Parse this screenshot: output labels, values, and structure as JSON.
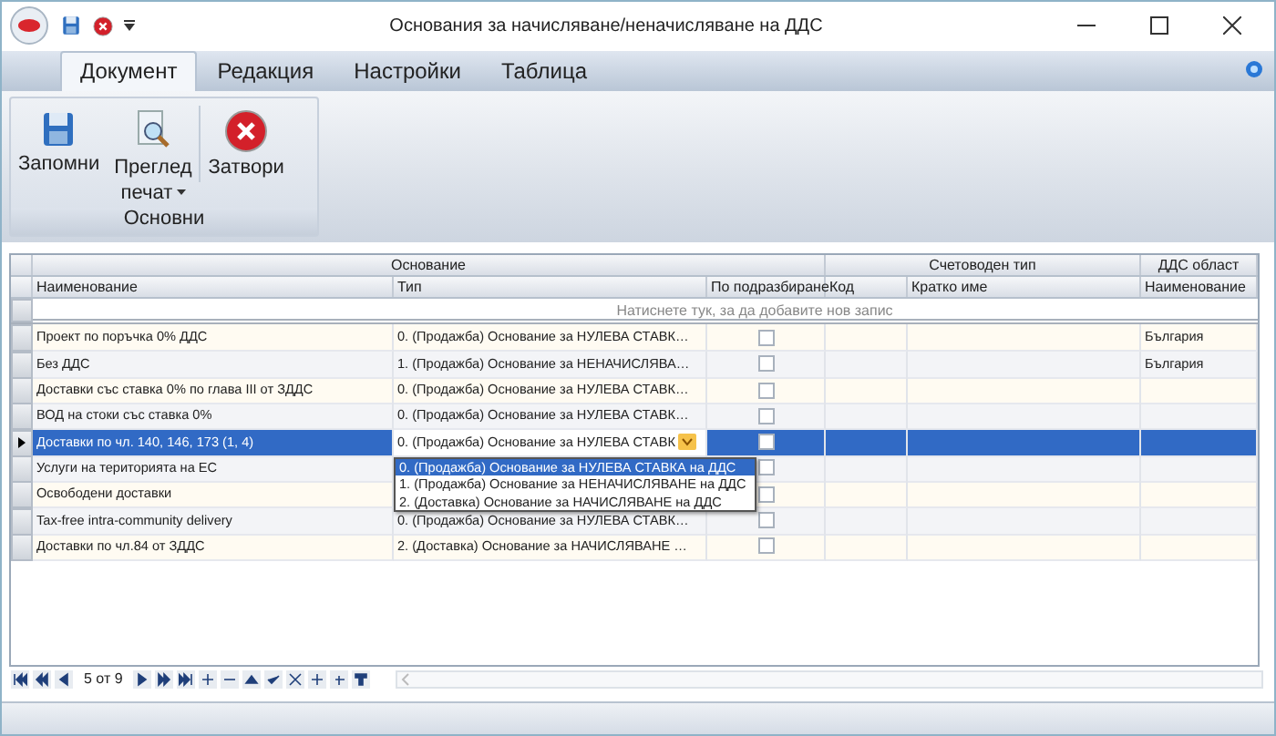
{
  "window": {
    "title": "Основания за начисляване/неначисляване на ДДС"
  },
  "tabs": [
    {
      "label": "Документ",
      "selected": true
    },
    {
      "label": "Редакция",
      "selected": false
    },
    {
      "label": "Настройки",
      "selected": false
    },
    {
      "label": "Таблица",
      "selected": false
    }
  ],
  "ribbon": {
    "group": "Основни",
    "buttons": [
      {
        "kind": "save",
        "lines": [
          "Запомни"
        ],
        "has_menu": false
      },
      {
        "kind": "preview",
        "lines": [
          "Преглед",
          "печат"
        ],
        "has_menu": true
      },
      {
        "kind": "close",
        "lines": [
          "Затвори"
        ],
        "has_menu": false
      }
    ]
  },
  "grid": {
    "bands": [
      {
        "label": "Основание",
        "columns": [
          "Наименование",
          "Тип",
          "По подразбиране"
        ]
      },
      {
        "label": "Счетоводен тип",
        "columns": [
          "Код",
          "Кратко име"
        ]
      },
      {
        "label": "ДДС област",
        "columns": [
          "Наименование"
        ]
      }
    ],
    "new_row_hint": "Натиснете тук, за да добавите нов запис",
    "rows": [
      {
        "name": "Проект по поръчка 0% ДДС",
        "type": "0. (Продажба) Основание за НУЛЕВА СТАВК…",
        "default": false,
        "vat_area": "България",
        "selected": false
      },
      {
        "name": "Без ДДС",
        "type": "1. (Продажба) Основание за НЕНАЧИСЛЯВА…",
        "default": false,
        "vat_area": "България",
        "selected": false
      },
      {
        "name": "Доставки със ставка 0% по глава III от ЗДДС",
        "type": "0. (Продажба) Основание за НУЛЕВА СТАВК…",
        "default": false,
        "selected": false
      },
      {
        "name": "ВОД на стоки със ставка 0%",
        "type": "0. (Продажба) Основание за НУЛЕВА СТАВК…",
        "default": false,
        "selected": false
      },
      {
        "name": "Доставки по чл. 140, 146, 173 (1, 4)",
        "type": "0. (Продажба) Основание за НУЛЕВА СТАВК",
        "default": false,
        "selected": true
      },
      {
        "name": "Услуги на територията на ЕС",
        "default": false,
        "selected": false
      },
      {
        "name": "Освободени доставки",
        "default": false,
        "selected": false
      },
      {
        "name": "Tax-free intra-community delivery",
        "type": "0. (Продажба) Основание за НУЛЕВА СТАВК…",
        "default": false,
        "selected": false
      },
      {
        "name": "Доставки по чл.84 от ЗДДС",
        "type": "2. (Доставка) Основание за НАЧИСЛЯВАНЕ …",
        "default": false,
        "selected": false
      }
    ],
    "type_dropdown": [
      {
        "label": "0. (Продажба) Основание за НУЛЕВА СТАВКА на ДДС",
        "selected": true
      },
      {
        "label": "1. (Продажба) Основание за НЕНАЧИСЛЯВАНЕ на ДДС",
        "selected": false
      },
      {
        "label": "2. (Доставка) Основание за НАЧИСЛЯВАНЕ на ДДС",
        "selected": false
      }
    ]
  },
  "navigator": {
    "position": "5 от 9"
  }
}
